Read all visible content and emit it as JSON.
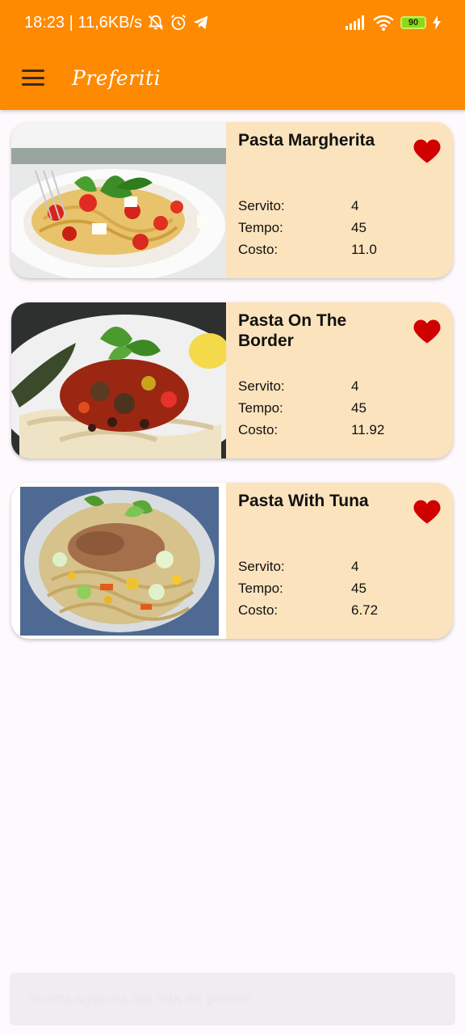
{
  "status_bar": {
    "time_speed": "18:23 | 11,6KB/s",
    "battery": "90",
    "icons": [
      "bell-muted-icon",
      "alarm-icon",
      "telegram-icon",
      "signal-icon",
      "wifi-icon",
      "battery-icon",
      "charging-icon"
    ]
  },
  "app_bar": {
    "title": "Preferiti",
    "menu_icon": "hamburger-menu-icon"
  },
  "labels": {
    "servings": "Servito:",
    "time": "Tempo:",
    "cost": "Costo:"
  },
  "recipes": [
    {
      "name": "Pasta Margherita",
      "servings": "4",
      "time": "45",
      "cost": "11.0",
      "favorite": true
    },
    {
      "name": "Pasta On The Border",
      "servings": "4",
      "time": "45",
      "cost": "11.92",
      "favorite": true
    },
    {
      "name": "Pasta With Tuna",
      "servings": "4",
      "time": "45",
      "cost": "6.72",
      "favorite": true
    }
  ],
  "snackbar": {
    "message": "Ricetta aggiunta alla lista dei preferiti"
  },
  "colors": {
    "primary": "#fe8a02",
    "card": "#fbe3bd",
    "heart": "#d10000",
    "background": "#fdf9fc"
  }
}
